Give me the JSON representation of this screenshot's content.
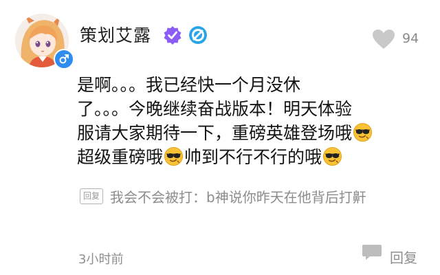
{
  "user": {
    "name": "策划艾露",
    "gender_icon": "male-icon",
    "verify_icon": "verified-badge-icon",
    "level_icon": "circle-badge-icon"
  },
  "likes": {
    "icon": "heart-icon",
    "count": "94"
  },
  "comment": {
    "lines": [
      {
        "segments": [
          {
            "text": "是啊。。。我已经快一个月没休"
          }
        ]
      },
      {
        "segments": [
          {
            "text": "了。。。今晚继续奋战版本！明天体验"
          }
        ]
      },
      {
        "segments": [
          {
            "text": "服请大家期待一下，重磅英雄登场哦"
          },
          {
            "emoji": "cool-sunglasses"
          }
        ]
      },
      {
        "segments": [
          {
            "text": "超级重磅哦"
          },
          {
            "emoji": "cool-sunglasses"
          },
          {
            "text": "帅到不行不行的哦"
          },
          {
            "emoji": "cool-sunglasses"
          }
        ]
      }
    ]
  },
  "reply": {
    "tag": "回复",
    "text": "我会不会被打：b神说你昨天在他背后打鼾"
  },
  "footer": {
    "timestamp": "3小时前",
    "reply_button": "回复",
    "reply_icon": "chat-bubble-icon"
  },
  "colors": {
    "primary_text": "#141414",
    "secondary_text": "#8c8c8c",
    "verify_purple": "#8b5cf6",
    "level_blue": "#2aa6e8",
    "gender_blue": "#2f8df0"
  }
}
